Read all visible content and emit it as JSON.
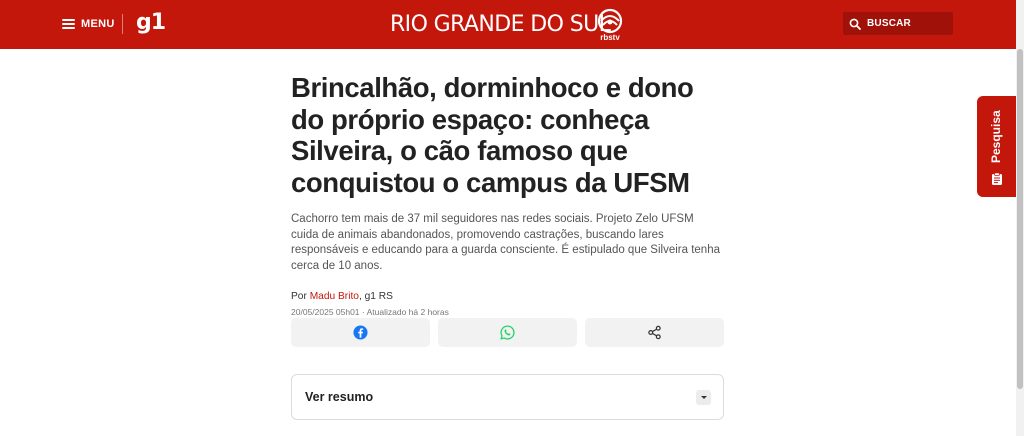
{
  "header": {
    "menu_label": "MENU",
    "logo_text": "g1",
    "region_title": "RIO GRANDE DO SUL",
    "affiliate_logo_text": "rbstv",
    "search_label": "BUSCAR"
  },
  "article": {
    "headline": "Brincalhão, dorminhoco e dono do próprio espaço: conheça Silveira, o cão famoso que conquistou o campus da UFSM",
    "subtitle": "Cachorro tem mais de 37 mil seguidores nas redes sociais. Projeto Zelo UFSM cuida de animais abandonados, promovendo castrações, buscando lares responsáveis e educando para a guarda consciente. É estipulado que Silveira tenha cerca de 10 anos.",
    "byline_prefix": "Por ",
    "author": "Madu Brito",
    "byline_suffix": ", g1 RS",
    "dateline": "20/05/2025 05h01 · Atualizado há 2 horas"
  },
  "share": {
    "buttons": [
      {
        "icon": "facebook-icon",
        "color": "#1877f2"
      },
      {
        "icon": "whatsapp-icon",
        "color": "#25d366"
      },
      {
        "icon": "share-icon",
        "color": "#333333"
      }
    ]
  },
  "summary": {
    "label": "Ver resumo"
  },
  "survey_tab": {
    "label": "Pesquisa"
  },
  "colors": {
    "brand": "#c4170c",
    "button_bg": "#f2f2f2"
  }
}
